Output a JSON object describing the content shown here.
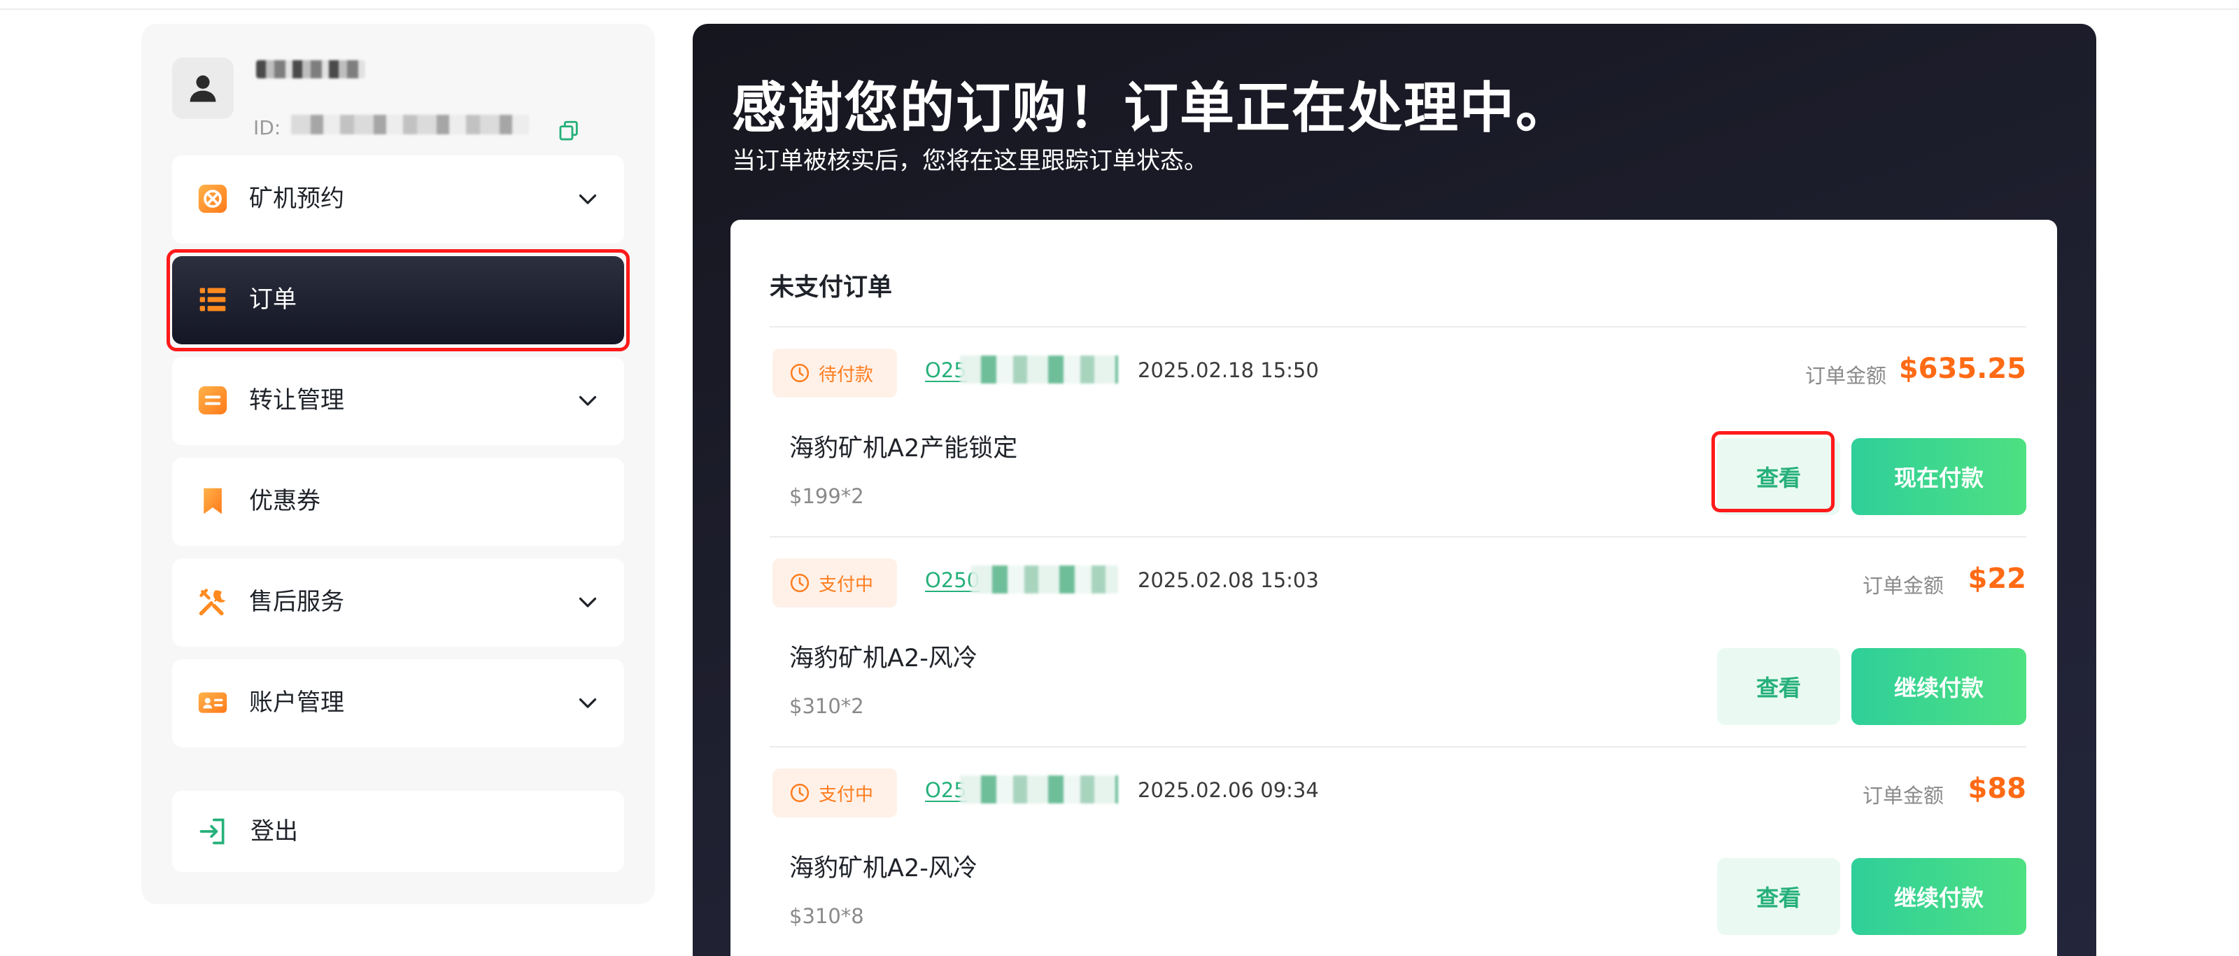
{
  "user": {
    "id_prefix": "ID:"
  },
  "sidebar": {
    "items": [
      {
        "label": "矿机预约",
        "icon": "mining-reservation-icon",
        "has_chevron": true
      },
      {
        "label": "订单",
        "icon": "list-icon",
        "active": true
      },
      {
        "label": "转让管理",
        "icon": "transfer-icon",
        "has_chevron": true
      },
      {
        "label": "优惠券",
        "icon": "bookmark-icon"
      },
      {
        "label": "售后服务",
        "icon": "tools-icon",
        "has_chevron": true
      },
      {
        "label": "账户管理",
        "icon": "id-card-icon",
        "has_chevron": true
      }
    ],
    "logout": "登出"
  },
  "main": {
    "title": "感谢您的订购！订单正在处理中。",
    "subtitle": "当订单被核实后，您将在这里跟踪订单状态。",
    "section_title": "未支付订单",
    "amount_label": "订单金额",
    "view_label": "查看",
    "orders": [
      {
        "status": "待付款",
        "id_prefix": "O25",
        "date": "2025.02.18 15:50",
        "amount": "$635.25",
        "product": "海豹矿机A2产能锁定",
        "price": "$199*2",
        "pay_label": "现在付款"
      },
      {
        "status": "支付中",
        "id_prefix": "O250",
        "date": "2025.02.08 15:03",
        "amount": "$22",
        "product": "海豹矿机A2-风冷",
        "price": "$310*2",
        "pay_label": "继续付款"
      },
      {
        "status": "支付中",
        "id_prefix": "O25",
        "date": "2025.02.06 09:34",
        "amount": "$88",
        "product": "海豹矿机A2-风冷",
        "price": "$310*8",
        "pay_label": "继续付款"
      }
    ]
  },
  "colors": {
    "accent_green": "#26b07a",
    "amount_orange": "#ff6a14",
    "highlight_red": "#ff1a1a",
    "sidebar_icon_orange": "#ff8a1f"
  }
}
